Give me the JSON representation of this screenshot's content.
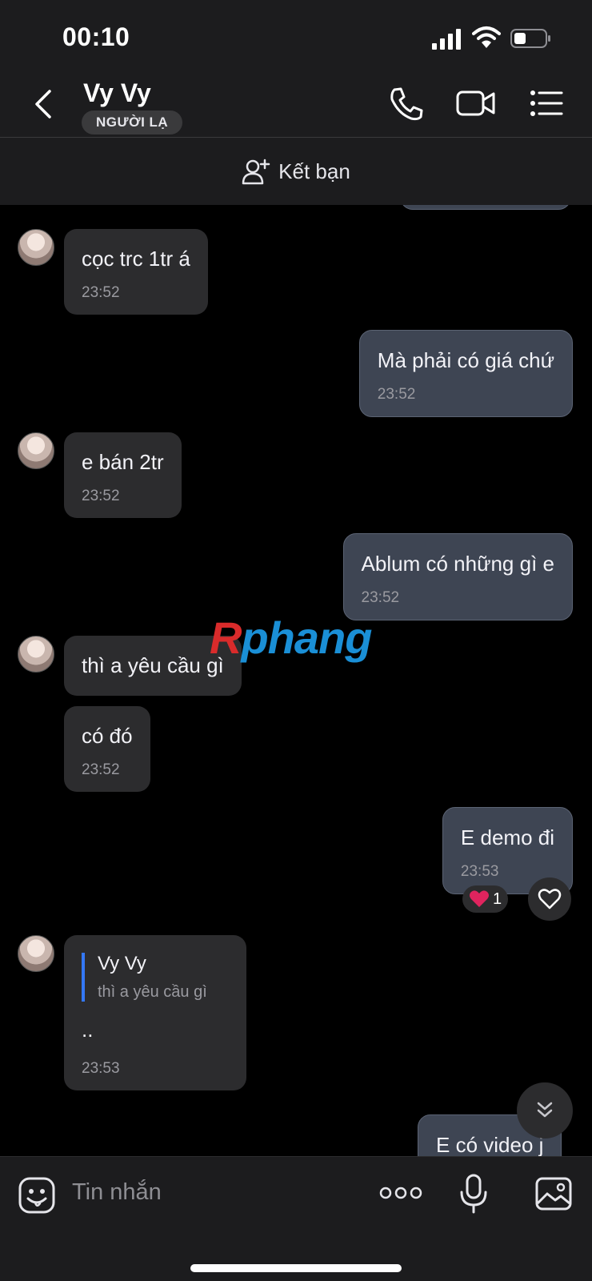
{
  "status_bar": {
    "time": "00:10"
  },
  "header": {
    "contact_name": "Vy Vy",
    "badge": "NGƯỜI LẠ"
  },
  "friend_bar": {
    "label": "Kết bạn"
  },
  "messages": [
    {
      "direction": "in",
      "text": "cọc trc 1tr á",
      "time": "23:52"
    },
    {
      "direction": "out",
      "text": "Mà phải có giá chứ",
      "time": "23:52"
    },
    {
      "direction": "in",
      "text": "e bán 2tr",
      "time": "23:52"
    },
    {
      "direction": "out",
      "text": "Ablum có những gì e",
      "time": "23:52"
    },
    {
      "direction": "in",
      "text": "thì a yêu cầu gì"
    },
    {
      "direction": "in",
      "text": "có đó",
      "time": "23:52"
    },
    {
      "direction": "out",
      "text": "E demo đi",
      "time": "23:53",
      "reaction": {
        "emoji": "❤️",
        "count": "1"
      }
    },
    {
      "direction": "in",
      "quote": {
        "name": "Vy Vy",
        "text": "thì a yêu cầu gì"
      },
      "text": "..",
      "time": "23:53"
    },
    {
      "direction": "out",
      "text": "E có video j"
    }
  ],
  "watermark": {
    "part1": "R",
    "part2": "phang"
  },
  "input": {
    "placeholder": "Tin nhắn"
  },
  "colors": {
    "outgoing_bubble": "#3e4553",
    "incoming_bubble": "#2c2c2e",
    "quote_accent": "#3478f6",
    "reaction_heart": "#e0245e"
  },
  "icons": [
    "back-icon",
    "phone-icon",
    "video-call-icon",
    "menu-list-icon",
    "add-friend-icon",
    "heart-icon",
    "chevron-double-down-icon",
    "emoji-icon",
    "more-icon",
    "microphone-icon",
    "image-icon"
  ]
}
